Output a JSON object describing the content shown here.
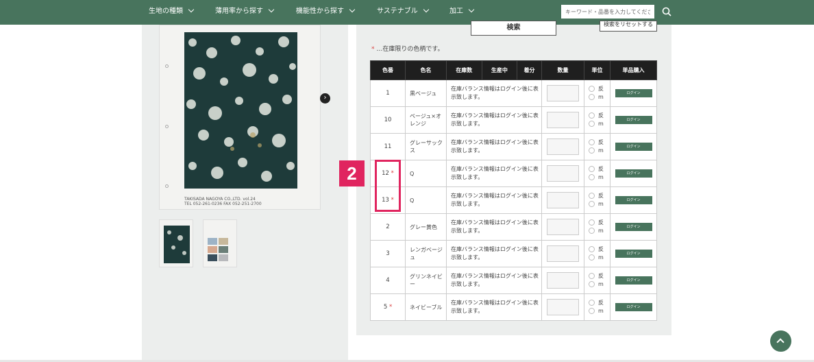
{
  "header": {
    "nav": [
      {
        "label": "生地の種類"
      },
      {
        "label": "薄用率から探す"
      },
      {
        "label": "機能性から探す"
      },
      {
        "label": "サステナブル"
      },
      {
        "label": "加工"
      }
    ],
    "search_placeholder": "キーワード・品番を入力してください"
  },
  "product": {
    "image_caption_1": "TAKISADA NAGOYA CO.,LTD. vol.24",
    "image_caption_2": "TEL 052-261-0236 FAX 052-251-2700"
  },
  "search_panel": {
    "search_label": "検索",
    "reset_label": "検索をリセットする",
    "note_star": "*",
    "note_text": "…在庫限りの色柄です。"
  },
  "table": {
    "headers": [
      "色番",
      "色名",
      "在庫数",
      "生産中",
      "着分",
      "数量",
      "単位",
      "単品購入"
    ],
    "rows": [
      {
        "num": "1",
        "star": "",
        "name": "黒ベージュ",
        "stock": "在庫バランス情報はログイン後に表示致します。",
        "unit1": "反",
        "unit2": "m",
        "buy": "ログイン"
      },
      {
        "num": "10",
        "star": "",
        "name": "ベージュ×オレンジ",
        "stock": "在庫バランス情報はログイン後に表示致します。",
        "unit1": "反",
        "unit2": "m",
        "buy": "ログイン"
      },
      {
        "num": "11",
        "star": "",
        "name": "グレーサックス",
        "stock": "在庫バランス情報はログイン後に表示致します。",
        "unit1": "反",
        "unit2": "m",
        "buy": "ログイン"
      },
      {
        "num": "12",
        "star": "*",
        "name": "Q",
        "stock": "在庫バランス情報はログイン後に表示致します。",
        "unit1": "反",
        "unit2": "m",
        "buy": "ログイン"
      },
      {
        "num": "13",
        "star": "*",
        "name": "Q",
        "stock": "在庫バランス情報はログイン後に表示致します。",
        "unit1": "反",
        "unit2": "m",
        "buy": "ログイン"
      },
      {
        "num": "2",
        "star": "",
        "name": "グレー黄色",
        "stock": "在庫バランス情報はログイン後に表示致します。",
        "unit1": "反",
        "unit2": "m",
        "buy": "ログイン"
      },
      {
        "num": "3",
        "star": "",
        "name": "レンガベージュ",
        "stock": "在庫バランス情報はログイン後に表示致します。",
        "unit1": "反",
        "unit2": "m",
        "buy": "ログイン"
      },
      {
        "num": "4",
        "star": "",
        "name": "グリンネイビー",
        "stock": "在庫バランス情報はログイン後に表示致します。",
        "unit1": "反",
        "unit2": "m",
        "buy": "ログイン"
      },
      {
        "num": "5",
        "star": "*",
        "name": "ネイビーブル",
        "stock": "在庫バランス情報はログイン後に表示致します。",
        "unit1": "反",
        "unit2": "m",
        "buy": "ログイン"
      }
    ]
  },
  "annotation": {
    "step": "2"
  },
  "colors": {
    "brand": "#48745d",
    "highlight": "#e0255f",
    "star": "#d94040"
  }
}
